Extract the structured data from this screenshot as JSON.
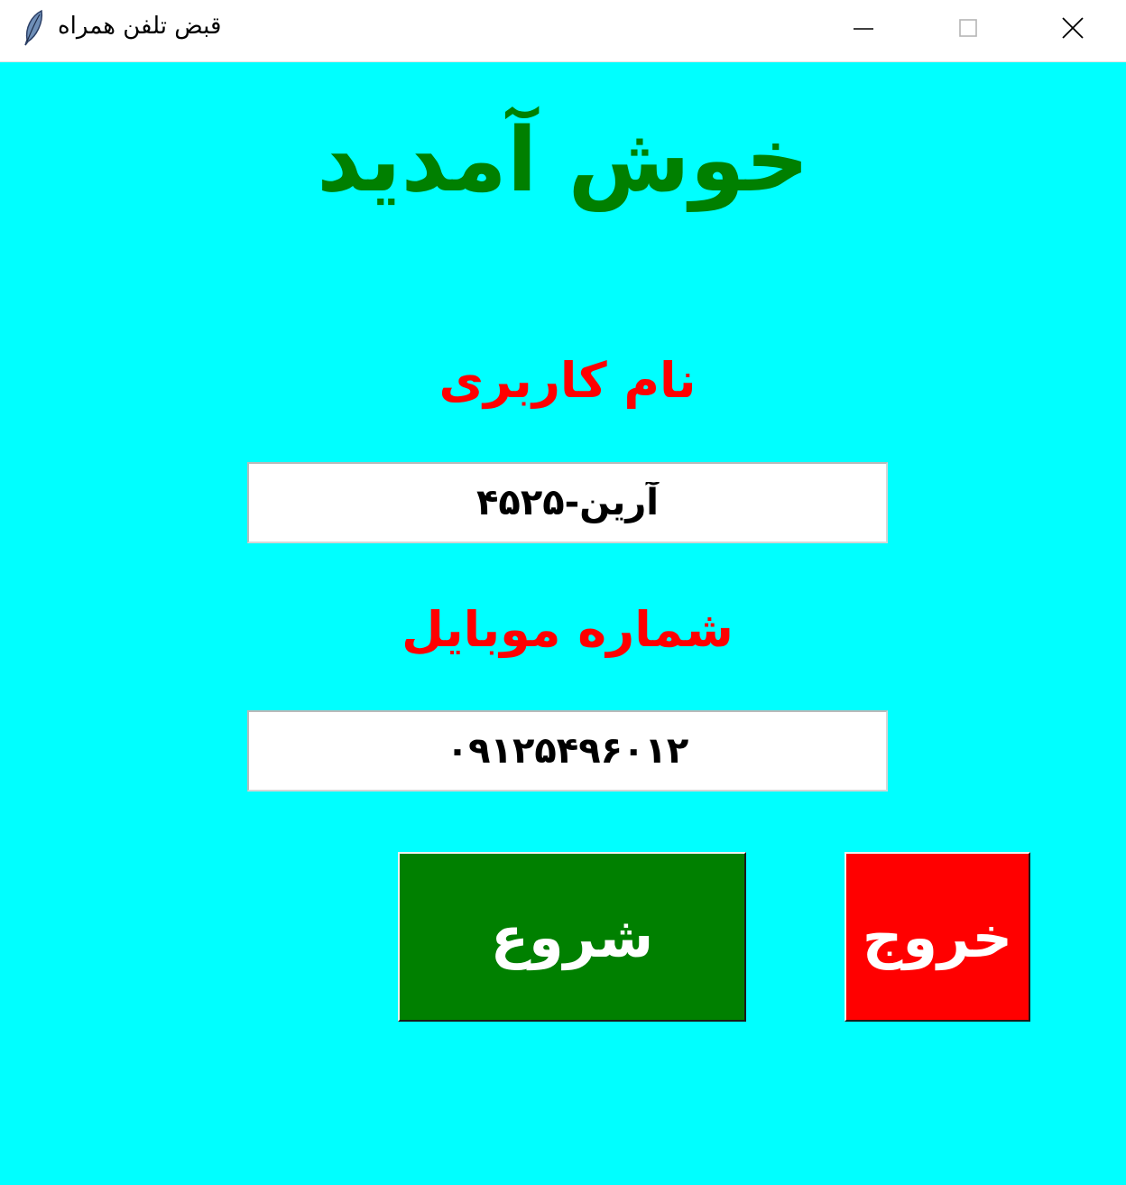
{
  "window": {
    "title": "قبض تلفن همراه",
    "background": "#00ffff",
    "icon": "feather-icon",
    "controls": [
      "minimize-icon",
      "maximize-icon",
      "close-icon"
    ]
  },
  "main": {
    "welcome": "خوش آمدید",
    "username_label": "نام کاربری",
    "username_value": "آرین-۴۵۲۵",
    "mobile_label": "شماره موبایل",
    "mobile_value": "۰۹۱۲۵۴۹۶۰۱۲",
    "start_button": "شروع",
    "exit_button": "خروج"
  },
  "colors": {
    "heading": "#008000",
    "labels": "#ff0000",
    "start_button_bg": "#008000",
    "exit_button_bg": "#ff0000",
    "button_text": "#ffffff"
  }
}
